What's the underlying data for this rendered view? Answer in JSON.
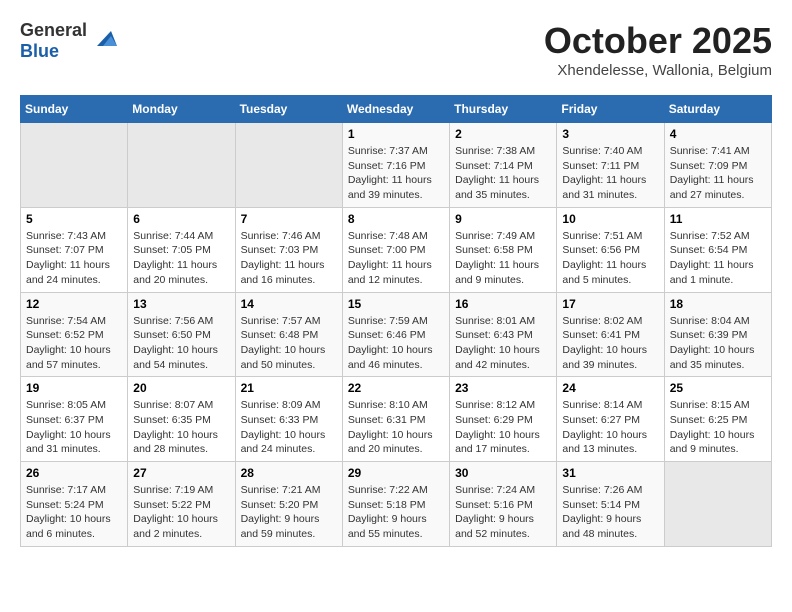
{
  "header": {
    "logo_general": "General",
    "logo_blue": "Blue",
    "month": "October 2025",
    "location": "Xhendelesse, Wallonia, Belgium"
  },
  "weekdays": [
    "Sunday",
    "Monday",
    "Tuesday",
    "Wednesday",
    "Thursday",
    "Friday",
    "Saturday"
  ],
  "weeks": [
    [
      {
        "day": "",
        "info": ""
      },
      {
        "day": "",
        "info": ""
      },
      {
        "day": "",
        "info": ""
      },
      {
        "day": "1",
        "info": "Sunrise: 7:37 AM\nSunset: 7:16 PM\nDaylight: 11 hours\nand 39 minutes."
      },
      {
        "day": "2",
        "info": "Sunrise: 7:38 AM\nSunset: 7:14 PM\nDaylight: 11 hours\nand 35 minutes."
      },
      {
        "day": "3",
        "info": "Sunrise: 7:40 AM\nSunset: 7:11 PM\nDaylight: 11 hours\nand 31 minutes."
      },
      {
        "day": "4",
        "info": "Sunrise: 7:41 AM\nSunset: 7:09 PM\nDaylight: 11 hours\nand 27 minutes."
      }
    ],
    [
      {
        "day": "5",
        "info": "Sunrise: 7:43 AM\nSunset: 7:07 PM\nDaylight: 11 hours\nand 24 minutes."
      },
      {
        "day": "6",
        "info": "Sunrise: 7:44 AM\nSunset: 7:05 PM\nDaylight: 11 hours\nand 20 minutes."
      },
      {
        "day": "7",
        "info": "Sunrise: 7:46 AM\nSunset: 7:03 PM\nDaylight: 11 hours\nand 16 minutes."
      },
      {
        "day": "8",
        "info": "Sunrise: 7:48 AM\nSunset: 7:00 PM\nDaylight: 11 hours\nand 12 minutes."
      },
      {
        "day": "9",
        "info": "Sunrise: 7:49 AM\nSunset: 6:58 PM\nDaylight: 11 hours\nand 9 minutes."
      },
      {
        "day": "10",
        "info": "Sunrise: 7:51 AM\nSunset: 6:56 PM\nDaylight: 11 hours\nand 5 minutes."
      },
      {
        "day": "11",
        "info": "Sunrise: 7:52 AM\nSunset: 6:54 PM\nDaylight: 11 hours\nand 1 minute."
      }
    ],
    [
      {
        "day": "12",
        "info": "Sunrise: 7:54 AM\nSunset: 6:52 PM\nDaylight: 10 hours\nand 57 minutes."
      },
      {
        "day": "13",
        "info": "Sunrise: 7:56 AM\nSunset: 6:50 PM\nDaylight: 10 hours\nand 54 minutes."
      },
      {
        "day": "14",
        "info": "Sunrise: 7:57 AM\nSunset: 6:48 PM\nDaylight: 10 hours\nand 50 minutes."
      },
      {
        "day": "15",
        "info": "Sunrise: 7:59 AM\nSunset: 6:46 PM\nDaylight: 10 hours\nand 46 minutes."
      },
      {
        "day": "16",
        "info": "Sunrise: 8:01 AM\nSunset: 6:43 PM\nDaylight: 10 hours\nand 42 minutes."
      },
      {
        "day": "17",
        "info": "Sunrise: 8:02 AM\nSunset: 6:41 PM\nDaylight: 10 hours\nand 39 minutes."
      },
      {
        "day": "18",
        "info": "Sunrise: 8:04 AM\nSunset: 6:39 PM\nDaylight: 10 hours\nand 35 minutes."
      }
    ],
    [
      {
        "day": "19",
        "info": "Sunrise: 8:05 AM\nSunset: 6:37 PM\nDaylight: 10 hours\nand 31 minutes."
      },
      {
        "day": "20",
        "info": "Sunrise: 8:07 AM\nSunset: 6:35 PM\nDaylight: 10 hours\nand 28 minutes."
      },
      {
        "day": "21",
        "info": "Sunrise: 8:09 AM\nSunset: 6:33 PM\nDaylight: 10 hours\nand 24 minutes."
      },
      {
        "day": "22",
        "info": "Sunrise: 8:10 AM\nSunset: 6:31 PM\nDaylight: 10 hours\nand 20 minutes."
      },
      {
        "day": "23",
        "info": "Sunrise: 8:12 AM\nSunset: 6:29 PM\nDaylight: 10 hours\nand 17 minutes."
      },
      {
        "day": "24",
        "info": "Sunrise: 8:14 AM\nSunset: 6:27 PM\nDaylight: 10 hours\nand 13 minutes."
      },
      {
        "day": "25",
        "info": "Sunrise: 8:15 AM\nSunset: 6:25 PM\nDaylight: 10 hours\nand 9 minutes."
      }
    ],
    [
      {
        "day": "26",
        "info": "Sunrise: 7:17 AM\nSunset: 5:24 PM\nDaylight: 10 hours\nand 6 minutes."
      },
      {
        "day": "27",
        "info": "Sunrise: 7:19 AM\nSunset: 5:22 PM\nDaylight: 10 hours\nand 2 minutes."
      },
      {
        "day": "28",
        "info": "Sunrise: 7:21 AM\nSunset: 5:20 PM\nDaylight: 9 hours\nand 59 minutes."
      },
      {
        "day": "29",
        "info": "Sunrise: 7:22 AM\nSunset: 5:18 PM\nDaylight: 9 hours\nand 55 minutes."
      },
      {
        "day": "30",
        "info": "Sunrise: 7:24 AM\nSunset: 5:16 PM\nDaylight: 9 hours\nand 52 minutes."
      },
      {
        "day": "31",
        "info": "Sunrise: 7:26 AM\nSunset: 5:14 PM\nDaylight: 9 hours\nand 48 minutes."
      },
      {
        "day": "",
        "info": ""
      }
    ]
  ]
}
